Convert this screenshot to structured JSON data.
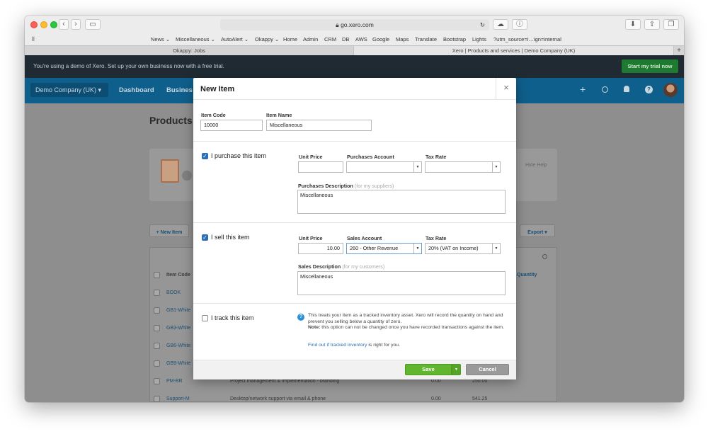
{
  "browser": {
    "url": "go.xero.com",
    "bookmarks": [
      "News ⌄",
      "Miscellaneous ⌄",
      "AutoAlert ⌄",
      "Okappy ⌄",
      "Home",
      "Admin",
      "CRM",
      "DB",
      "AWS",
      "Google",
      "Maps",
      "Translate",
      "Bootstrap",
      "Lights",
      "?utm_source=i…ign=internal"
    ],
    "tabs": [
      "Okappy: Jobs",
      "Xero | Products and services | Demo Company (UK)"
    ],
    "new_tab": "+"
  },
  "trial_banner": {
    "text": "You're using a demo of Xero. Set up your own business now with a free trial.",
    "cta": "Start my trial now"
  },
  "header": {
    "org": "Demo Company (UK)",
    "org_caret": "▾",
    "nav": [
      "Dashboard",
      "Busines"
    ],
    "icons": {
      "plus": "+",
      "help": "?"
    }
  },
  "background_page": {
    "title": "Products",
    "hide_help": "Hide Help",
    "new_item": "+ New Item",
    "export": "Export ▾",
    "col_item_code": "Item Code",
    "col_quantity": "Quantity",
    "rows": [
      {
        "code": "BOOK",
        "desc": "",
        "v1": "",
        "v2": ""
      },
      {
        "code": "GB1-White",
        "desc": "",
        "v1": "",
        "v2": ""
      },
      {
        "code": "GB3-White",
        "desc": "",
        "v1": "",
        "v2": ""
      },
      {
        "code": "GB6-White",
        "desc": "",
        "v1": "",
        "v2": ""
      },
      {
        "code": "GB9-White",
        "desc": "",
        "v1": "",
        "v2": ""
      },
      {
        "code": "PM-BR",
        "desc": "Project management & implementation - branding",
        "v1": "0.00",
        "v2": "250.00"
      },
      {
        "code": "Support-M",
        "desc": "Desktop/network support via email & phone",
        "v1": "0.00",
        "v2": "541.25"
      }
    ]
  },
  "modal": {
    "title": "New Item",
    "close": "×",
    "item_code_label": "Item Code",
    "item_code_value": "10000",
    "item_name_label": "Item Name",
    "item_name_value": "Miscellaneous",
    "purchase": {
      "checkbox_label": "I purchase this item",
      "checked": true,
      "unit_price_label": "Unit Price",
      "unit_price_value": "",
      "account_label": "Purchases Account",
      "account_value": "",
      "tax_label": "Tax Rate",
      "tax_value": "",
      "desc_label": "Purchases Description",
      "desc_hint": "(for my suppliers)",
      "desc_value": "Miscellaneous"
    },
    "sell": {
      "checkbox_label": "I sell this item",
      "checked": true,
      "unit_price_label": "Unit Price",
      "unit_price_value": "10.00",
      "account_label": "Sales Account",
      "account_value": "260 - Other Revenue",
      "tax_label": "Tax Rate",
      "tax_value": "20% (VAT on Income)",
      "desc_label": "Sales Description",
      "desc_hint": "(for my customers)",
      "desc_value": "Miscellaneous"
    },
    "track": {
      "checkbox_label": "I track this item",
      "checked": false,
      "info_text": "This treats your item as a tracked inventory asset. Xero will record the quantity on hand and prevent you selling below a quantity of zero.",
      "note_label": "Note:",
      "note_text": "this option can not be changed once you have recorded transactions against the item.",
      "link_pre": "Find out if",
      "link_text": "tracked inventory",
      "link_post": "is right for you."
    },
    "save": "Save",
    "cancel": "Cancel"
  },
  "colors": {
    "xero_blue": "#0f5f8c",
    "trial_bar": "#1f2a33",
    "cta_green": "#29a03c",
    "save_green": "#62b52f",
    "link_blue": "#2a6fb5"
  }
}
